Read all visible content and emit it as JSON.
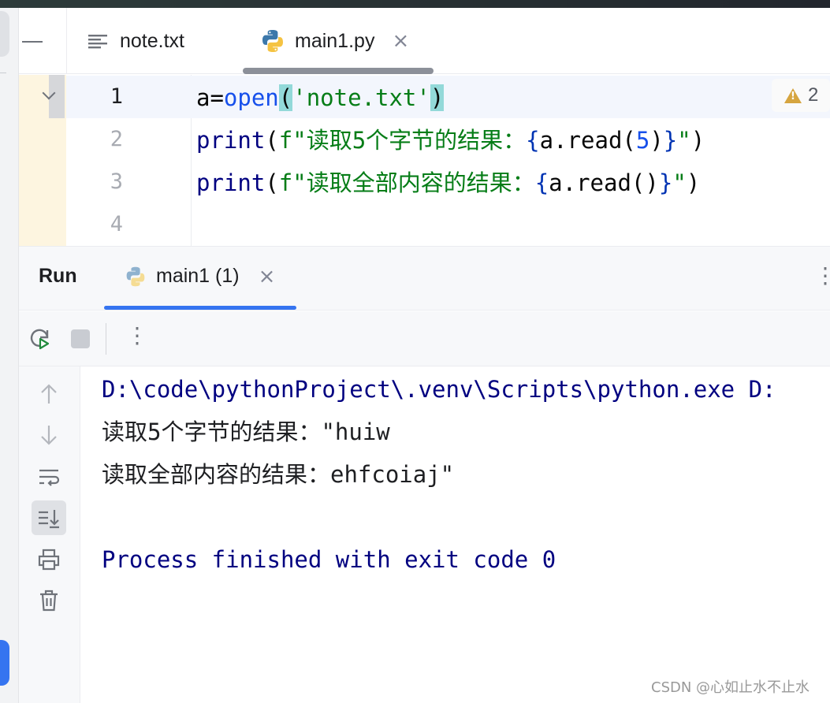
{
  "tabs": [
    {
      "label": "note.txt",
      "icon": "text-file-icon",
      "active": false
    },
    {
      "label": "main1.py",
      "icon": "python-icon",
      "active": true,
      "close": "×"
    }
  ],
  "editor": {
    "line_numbers": [
      "1",
      "2",
      "3",
      "4"
    ],
    "lines": [
      {
        "segments": [
          {
            "text": "a=",
            "cls": "c-plain"
          },
          {
            "text": "open",
            "cls": "c-fn"
          },
          {
            "text": "(",
            "cls": "c-plain c-match"
          },
          {
            "text": "'note.txt'",
            "cls": "c-str"
          },
          {
            "text": ")",
            "cls": "c-plain c-match"
          }
        ]
      },
      {
        "segments": [
          {
            "text": "print",
            "cls": "c-bi"
          },
          {
            "text": "(",
            "cls": "c-plain"
          },
          {
            "text": "f\"读取5个字节的结果：",
            "cls": "c-str"
          },
          {
            "text": "{",
            "cls": "c-brace"
          },
          {
            "text": "a.read(",
            "cls": "c-plain"
          },
          {
            "text": "5",
            "cls": "c-num"
          },
          {
            "text": ")",
            "cls": "c-plain"
          },
          {
            "text": "}",
            "cls": "c-brace"
          },
          {
            "text": "\"",
            "cls": "c-str"
          },
          {
            "text": ")",
            "cls": "c-plain"
          }
        ]
      },
      {
        "segments": [
          {
            "text": "print",
            "cls": "c-bi"
          },
          {
            "text": "(",
            "cls": "c-plain"
          },
          {
            "text": "f\"读取全部内容的结果：",
            "cls": "c-str"
          },
          {
            "text": "{",
            "cls": "c-brace"
          },
          {
            "text": "a.read()",
            "cls": "c-plain"
          },
          {
            "text": "}",
            "cls": "c-brace"
          },
          {
            "text": "\"",
            "cls": "c-str"
          },
          {
            "text": ")",
            "cls": "c-plain"
          }
        ]
      },
      {
        "segments": []
      }
    ],
    "warnings_count": "2"
  },
  "run": {
    "title": "Run",
    "tab_label": "main1 (1)",
    "tab_close": "×",
    "more": "⋮",
    "output": [
      {
        "text": "D:\\code\\pythonProject\\.venv\\Scripts\\python.exe D:",
        "cls": "out-path"
      },
      {
        "text": "读取5个字节的结果：\"huiw",
        "cls": "out-text"
      },
      {
        "text": "读取全部内容的结果：ehfcoiaj\"",
        "cls": "out-text"
      },
      {
        "text": "",
        "cls": "out-text"
      },
      {
        "text": "Process finished with exit code 0",
        "cls": "out-exit"
      }
    ]
  },
  "colors": {
    "accent": "#3574f0",
    "string": "#067d17",
    "builtin": "#000080",
    "function": "#1750eb",
    "brace_match": "#93d9d9",
    "warning": "#d6a53f"
  },
  "watermark": "CSDN @心如止水不止水"
}
